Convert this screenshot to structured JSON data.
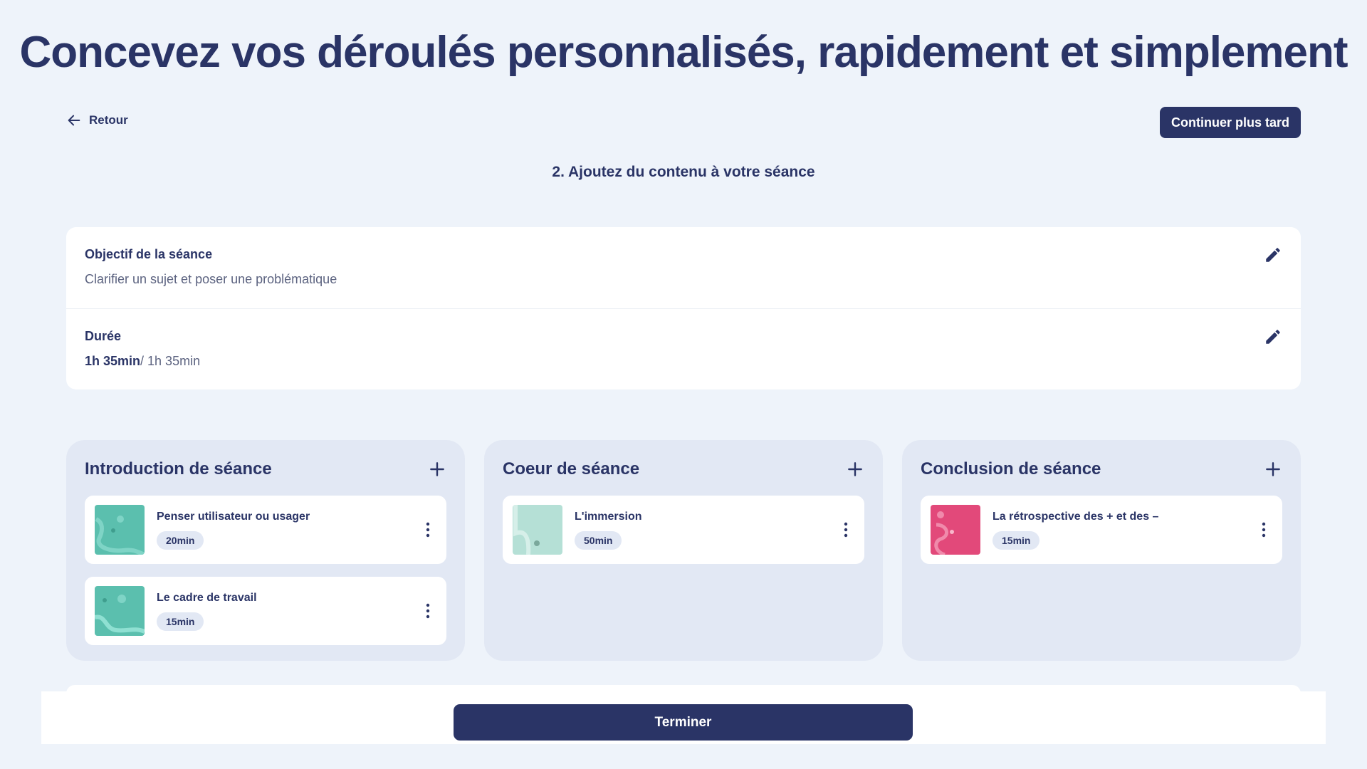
{
  "header": {
    "title": "Concevez vos déroulés personnalisés, rapidement et simplement",
    "back_label": "Retour",
    "later_label": "Continuer plus tard",
    "step_title": "2. Ajoutez du contenu à votre séance"
  },
  "info": {
    "objective_label": "Objectif de la séance",
    "objective_value": "Clarifier un sujet et poser une problématique",
    "duration_label": "Durée",
    "duration_current": "1h 35min",
    "duration_total": "/ 1h 35min"
  },
  "columns": [
    {
      "title": "Introduction de séance",
      "items": [
        {
          "title": "Penser utilisateur ou usager",
          "duration": "20min",
          "thumb_color": "#5bbfae"
        },
        {
          "title": "Le cadre de travail",
          "duration": "15min",
          "thumb_color": "#5bbfae"
        }
      ]
    },
    {
      "title": "Coeur de séance",
      "items": [
        {
          "title": "L'immersion",
          "duration": "50min",
          "thumb_color": "#b5e0d6"
        }
      ]
    },
    {
      "title": "Conclusion de séance",
      "items": [
        {
          "title": "La rétrospective des + et des –",
          "duration": "15min",
          "thumb_color": "#e2497a"
        }
      ]
    }
  ],
  "footer": {
    "finish_label": "Terminer"
  },
  "colors": {
    "primary": "#2a3466",
    "background": "#eef3fa",
    "column_bg": "#e2e8f4"
  }
}
